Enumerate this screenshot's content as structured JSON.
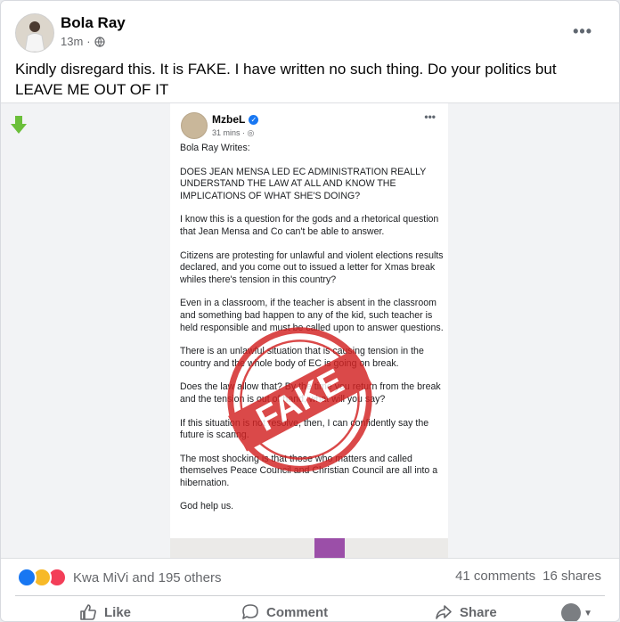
{
  "post": {
    "author": "Bola Ray",
    "time": "13m",
    "audience_icon": "globe-icon",
    "caption": "Kindly disregard this. It is FAKE. I have written no such thing. Do your politics but LEAVE ME OUT OF IT"
  },
  "shared_post": {
    "author": "MzbeL",
    "time": "31 mins",
    "verified": true,
    "paragraphs": [
      "Bola Ray Writes:",
      "DOES JEAN MENSA LED EC ADMINISTRATION REALLY UNDERSTAND THE LAW AT ALL AND KNOW THE IMPLICATIONS OF WHAT SHE'S DOING?",
      "I know this is a question for the gods and a rhetorical question that Jean Mensa and Co can't be able to answer.",
      "Citizens are protesting for unlawful and violent elections results declared, and you come out to issued a letter for Xmas break whiles there's tension in this country?",
      "Even in a classroom, if the teacher is absent in the classroom and something bad happen to any of the kid, such teacher is held responsible and must be called upon to answer questions.",
      "There is an unlawful situation that is causing tension in the country and the whole body of EC is going on break.",
      "Does the law allow that? By the time you return from the break and the tension is out of hand, what will you say?",
      "If this situation is not resolve, then, I can confidently say the future is scaring.",
      "The most shocking is that those who matters and called themselves Peace Council and Christian Council are all into a hibernation.",
      "God help us."
    ],
    "stamp_text": "FAKE"
  },
  "reactions": {
    "icons": [
      "like-icon",
      "haha-icon",
      "love-icon"
    ],
    "summary": "Kwa MiVi and 195 others",
    "comments": "41 comments",
    "shares": "16 shares"
  },
  "actions": {
    "like": "Like",
    "comment": "Comment",
    "share": "Share"
  },
  "colors": {
    "brand_blue": "#1877f2",
    "stamp_red": "#d22222",
    "arrow_green": "#6bbf3a",
    "muted_text": "#65676b"
  }
}
